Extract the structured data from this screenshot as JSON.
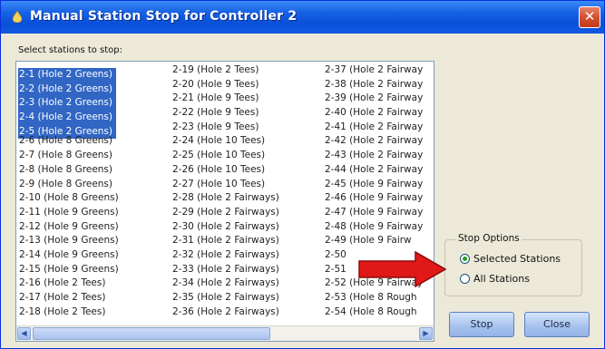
{
  "window": {
    "title": "Manual Station Stop for Controller 2",
    "close_glyph": "✕"
  },
  "stations": {
    "label": "Select stations to stop:",
    "columns": [
      [
        {
          "text": "2-1  (Hole 2 Greens)",
          "selected": true
        },
        {
          "text": "2-2  (Hole 2 Greens)",
          "selected": true
        },
        {
          "text": "2-3  (Hole 2 Greens)",
          "selected": true
        },
        {
          "text": "2-4  (Hole 2 Greens)",
          "selected": true
        },
        {
          "text": "2-5  (Hole 2 Greens)",
          "selected": true
        },
        {
          "text": "2-6  (Hole 8 Greens)",
          "selected": false
        },
        {
          "text": "2-7  (Hole 8 Greens)",
          "selected": false
        },
        {
          "text": "2-8  (Hole 8 Greens)",
          "selected": false
        },
        {
          "text": "2-9  (Hole 8 Greens)",
          "selected": false
        },
        {
          "text": "2-10  (Hole 8 Greens)",
          "selected": false
        },
        {
          "text": "2-11  (Hole 9 Greens)",
          "selected": false
        },
        {
          "text": "2-12  (Hole 9 Greens)",
          "selected": false
        },
        {
          "text": "2-13  (Hole 9 Greens)",
          "selected": false
        },
        {
          "text": "2-14  (Hole 9 Greens)",
          "selected": false
        },
        {
          "text": "2-15  (Hole 9 Greens)",
          "selected": false
        },
        {
          "text": "2-16  (Hole 2 Tees)",
          "selected": false
        },
        {
          "text": "2-17  (Hole 2 Tees)",
          "selected": false
        },
        {
          "text": "2-18  (Hole 2 Tees)",
          "selected": false
        }
      ],
      [
        {
          "text": "2-19  (Hole 2 Tees)",
          "selected": false
        },
        {
          "text": "2-20  (Hole 9 Tees)",
          "selected": false
        },
        {
          "text": "2-21  (Hole 9 Tees)",
          "selected": false
        },
        {
          "text": "2-22  (Hole 9 Tees)",
          "selected": false
        },
        {
          "text": "2-23  (Hole 9 Tees)",
          "selected": false
        },
        {
          "text": "2-24  (Hole 10 Tees)",
          "selected": false
        },
        {
          "text": "2-25  (Hole 10 Tees)",
          "selected": false
        },
        {
          "text": "2-26  (Hole 10 Tees)",
          "selected": false
        },
        {
          "text": "2-27  (Hole 10 Tees)",
          "selected": false
        },
        {
          "text": "2-28  (Hole 2 Fairways)",
          "selected": false
        },
        {
          "text": "2-29  (Hole 2 Fairways)",
          "selected": false
        },
        {
          "text": "2-30  (Hole 2 Fairways)",
          "selected": false
        },
        {
          "text": "2-31  (Hole 2 Fairways)",
          "selected": false
        },
        {
          "text": "2-32  (Hole 2 Fairways)",
          "selected": false
        },
        {
          "text": "2-33  (Hole 2 Fairways)",
          "selected": false
        },
        {
          "text": "2-34  (Hole 2 Fairways)",
          "selected": false
        },
        {
          "text": "2-35  (Hole 2 Fairways)",
          "selected": false
        },
        {
          "text": "2-36  (Hole 2 Fairways)",
          "selected": false
        }
      ],
      [
        {
          "text": "2-37  (Hole 2 Fairway",
          "selected": false
        },
        {
          "text": "2-38  (Hole 2 Fairway",
          "selected": false
        },
        {
          "text": "2-39  (Hole 2 Fairway",
          "selected": false
        },
        {
          "text": "2-40  (Hole 2 Fairway",
          "selected": false
        },
        {
          "text": "2-41  (Hole 2 Fairway",
          "selected": false
        },
        {
          "text": "2-42  (Hole 2 Fairway",
          "selected": false
        },
        {
          "text": "2-43  (Hole 2 Fairway",
          "selected": false
        },
        {
          "text": "2-44  (Hole 2 Fairway",
          "selected": false
        },
        {
          "text": "2-45  (Hole 9 Fairway",
          "selected": false
        },
        {
          "text": "2-46  (Hole 9 Fairway",
          "selected": false
        },
        {
          "text": "2-47  (Hole 9 Fairway",
          "selected": false
        },
        {
          "text": "2-48  (Hole 9 Fairway",
          "selected": false
        },
        {
          "text": "2-49  (Hole 9 Fairw",
          "selected": false
        },
        {
          "text": "2-50",
          "selected": false
        },
        {
          "text": "2-51",
          "selected": false
        },
        {
          "text": "2-52  (Hole 9 Fairway",
          "selected": false
        },
        {
          "text": "2-53  (Hole 8 Rough",
          "selected": false
        },
        {
          "text": "2-54  (Hole 8 Rough",
          "selected": false
        }
      ]
    ],
    "scroll_left": "◀",
    "scroll_right": "▶"
  },
  "stop_options": {
    "label": "Stop Options",
    "selected_stations": "Selected Stations",
    "all_stations": "All Stations",
    "checked": "selected_stations"
  },
  "buttons": {
    "stop": "Stop",
    "close": "Close"
  },
  "colors": {
    "title_bar": "#0a4fd8",
    "selection": "#3166c4",
    "arrow": "#e01818"
  }
}
